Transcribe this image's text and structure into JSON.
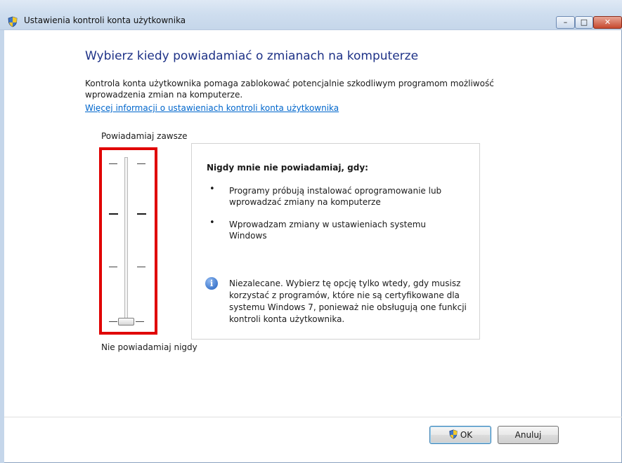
{
  "window": {
    "title": "Ustawienia kontroli konta użytkownika",
    "title_icon": "uac-shield-icon",
    "controls": {
      "minimize": "–",
      "maximize": "□",
      "close": "✕"
    }
  },
  "main": {
    "heading": "Wybierz kiedy powiadamiać o zmianach na komputerze",
    "description": "Kontrola konta użytkownika pomaga zablokować potencjalnie szkodliwym programom możliwość wprowadzenia zmian na komputerze.",
    "link": "Więcej informacji o ustawieniach kontroli konta użytkownika"
  },
  "slider": {
    "top_label": "Powiadamiaj zawsze",
    "bottom_label": "Nie powiadamiaj nigdy",
    "levels": 4,
    "selected_level": 1
  },
  "info": {
    "title": "Nigdy mnie nie powiadamiaj, gdy:",
    "bullet_glyph": "•",
    "bullets": [
      "Programy próbują instalować oprogramowanie lub wprowadzać zmiany na komputerze",
      "Wprowadzam zmiany w ustawieniach systemu Windows"
    ],
    "warning_icon": "info-icon",
    "warning_glyph": "i",
    "warning": "Niezalecane. Wybierz tę opcję tylko wtedy, gdy musisz korzystać z programów, które nie są certyfikowane dla systemu Windows 7, ponieważ nie obsługują one funkcji kontroli konta użytkownika."
  },
  "buttons": {
    "ok": "OK",
    "cancel": "Anuluj"
  },
  "colors": {
    "heading": "#1e3287",
    "link": "#0066cc",
    "highlight": "#e00000"
  }
}
